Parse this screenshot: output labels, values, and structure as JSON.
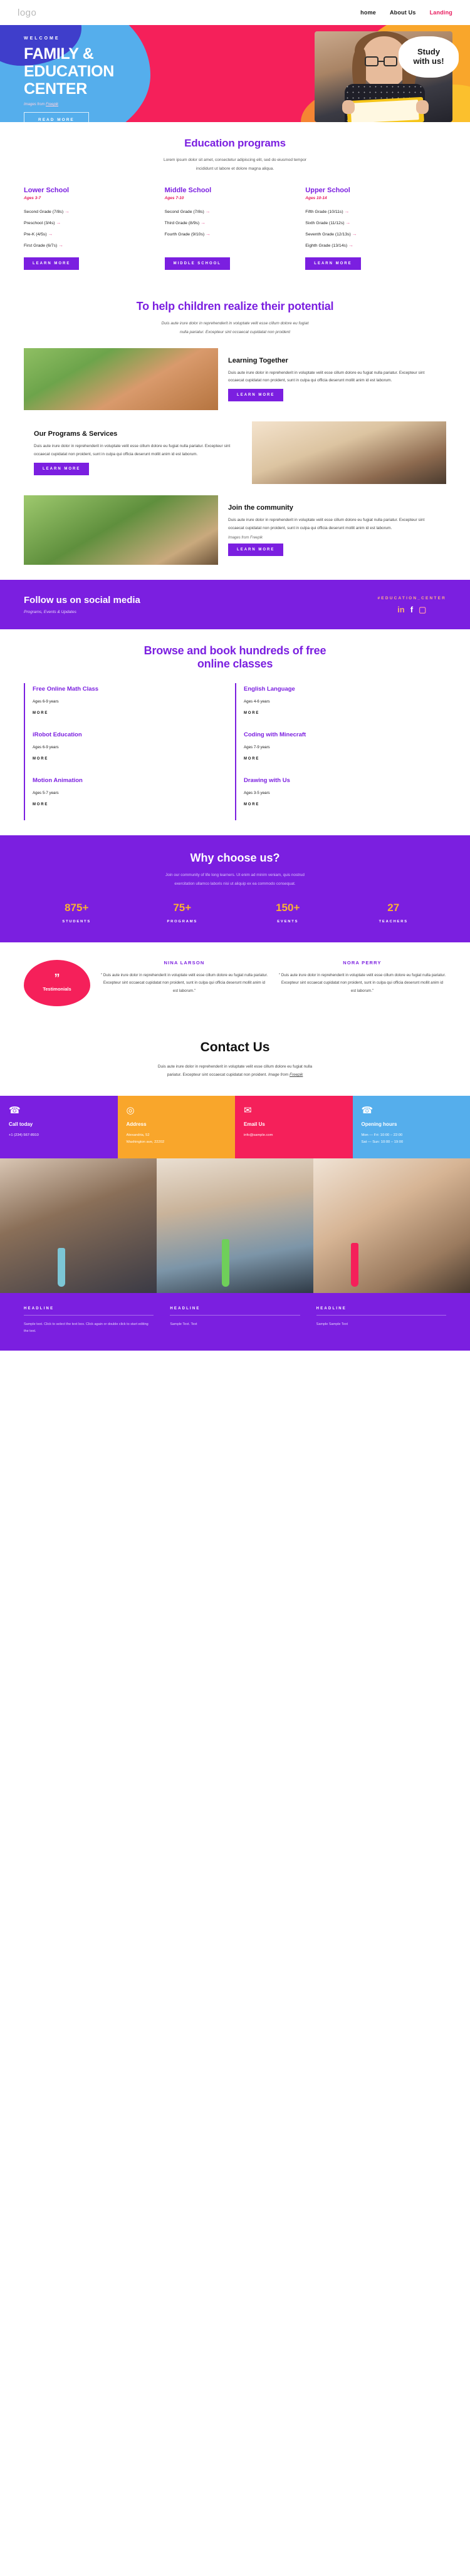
{
  "header": {
    "logo": "logo",
    "nav": [
      {
        "label": "home",
        "active": false
      },
      {
        "label": "About Us",
        "active": false
      },
      {
        "label": "Landing",
        "active": true
      }
    ]
  },
  "hero": {
    "welcome": "WELCOME",
    "title_line1": "FAMILY &",
    "title_line2": "EDUCATION",
    "title_line3": "CENTER",
    "credit_prefix": "Images from ",
    "credit_link": "Freepik",
    "cta": "READ MORE",
    "bubble_line1": "Study",
    "bubble_line2": "with us!"
  },
  "programs": {
    "title": "Education programs",
    "subtitle_line1": "Lorem ipsum dolor sit amet, consectetur adipiscing elit, sed do eiusmod tempor",
    "subtitle_line2": "incididunt ut labore et dolore magna aliqua.",
    "columns": [
      {
        "name": "Lower School",
        "ages": "Ages 3-7",
        "items": [
          "Second Grade (7/8s)",
          "Preschool (3/4s)",
          "Pre-K (4/5s)",
          "First Grade (6/7s)"
        ],
        "button": "LEARN MORE"
      },
      {
        "name": "Middle School",
        "ages": "Ages 7-10",
        "items": [
          "Second Grade (7/8s)",
          "Third Grade (8/9s)",
          "Fourth Grade (9/10s)"
        ],
        "button": "MIDDLE SCHOOL"
      },
      {
        "name": "Upper School",
        "ages": "Ages 10-14",
        "items": [
          "Fifth Grade (10/11s)",
          "Sixth Grade (11/12s)",
          "Seventh Grade (12/13s)",
          "Eighth Grade (13/14s)"
        ],
        "button": "LEARN MORE"
      }
    ]
  },
  "potential": {
    "title": "To help children realize their potential",
    "sub_line1": "Duis aute irure dolor in reprehenderit in voluptate velit esse cillum dolore eu fugiat",
    "sub_line2": "nulla pariatur. Excepteur sint occaecat cupidatat non proident",
    "cards": [
      {
        "title": "Learning Together",
        "body": "Duis aute irure dolor in reprehenderit in voluptate velit esse cillum dolore eu fugiat nulla pariatur. Excepteur sint occaecat cupidatat non proident, sunt in culpa qui officia deserunt mollit anim id est laborum.",
        "button": "LEARN MORE",
        "credit": ""
      },
      {
        "title": "Our Programs & Services",
        "body": "Duis aute irure dolor in reprehenderit in voluptate velit esse cillum dolore eu fugiat nulla pariatur. Excepteur sint occaecat cupidatat non proident, sunt in culpa qui officia deserunt mollit anim id est laborum.",
        "button": "LEARN MORE",
        "credit": ""
      },
      {
        "title": "Join the community",
        "body": "Duis aute irure dolor in reprehenderit in voluptate velit esse cillum dolore eu fugiat nulla pariatur. Excepteur sint occaecat cupidatat non proident, sunt in culpa qui officia deserunt mollit anim id est laborum.",
        "button": "LEARN MORE",
        "credit": "Images from Freepik"
      }
    ]
  },
  "social": {
    "title": "Follow us on social media",
    "subtitle": "Programs, Events & Updates",
    "hashtag": "#EDUCATION_CENTER",
    "icons": [
      "linkedin-icon",
      "facebook-icon",
      "instagram-icon"
    ]
  },
  "classes": {
    "title_line1": "Browse and book hundreds of free",
    "title_line2": "online classes",
    "more_label": "MORE",
    "items": [
      {
        "name": "Free Online Math Class",
        "ages": "Ages 6-9 years"
      },
      {
        "name": "English Language",
        "ages": "Ages 4-6 years"
      },
      {
        "name": "iRobot Education",
        "ages": "Ages 6-9 years"
      },
      {
        "name": "Coding with Minecraft",
        "ages": "Ages 7-9 years"
      },
      {
        "name": "Motion Animation",
        "ages": "Ages 5-7 years"
      },
      {
        "name": "Drawing with Us",
        "ages": "Ages 3-5 years"
      }
    ]
  },
  "why": {
    "title": "Why choose us?",
    "sub_line1": "Join our community of life long learners. Ut enim ad minim veniam, quis nostrud",
    "sub_line2": "exercitation ullamco laboris nisi ut aliquip ex ea commodo consequat.",
    "stats": [
      {
        "number": "875+",
        "label": "STUDENTS"
      },
      {
        "number": "75+",
        "label": "PROGRAMS"
      },
      {
        "number": "150+",
        "label": "EVENTS"
      },
      {
        "number": "27",
        "label": "TEACHERS"
      }
    ]
  },
  "testimonials": {
    "badge_quote": "”",
    "badge_label": "Testimonials",
    "entries": [
      {
        "name": "NINA LARSON",
        "text": "\" Duis aute irure dolor in reprehenderit in voluptate velit esse cillum dolore eu fugiat nulla pariatur. Excepteur sint occaecat cupidatat non proident, sunt in culpa qui officia deserunt mollit anim id est laborum.\""
      },
      {
        "name": "NORA PERRY",
        "text": "\" Duis aute irure dolor in reprehenderit in voluptate velit esse cillum dolore eu fugiat nulla pariatur. Excepteur sint occaecat cupidatat non proident, sunt in culpa qui officia deserunt mollit anim id est laborum.\""
      }
    ]
  },
  "contact": {
    "title": "Contact Us",
    "desc_line1": "Duis aute irure dolor in reprehenderit in voluptate velit esse cillum dolore eu fugiat nulla",
    "desc_line2": "pariatur. Excepteur sint occaecat cupidatat non proident. ",
    "desc_credit_prefix": "Image from ",
    "desc_credit_link": "Freepik",
    "cards": [
      {
        "icon": "phone-icon",
        "glyph": "☎",
        "title": "Call today",
        "line1": "+1 (234) 567-8910",
        "line2": ""
      },
      {
        "icon": "location-icon",
        "glyph": "◎",
        "title": "Address",
        "line1": "Alexandria, 52",
        "line2": "Washington ave, 22202"
      },
      {
        "icon": "mail-icon",
        "glyph": "✉",
        "title": "Email Us",
        "line1": "info@sample.com",
        "line2": ""
      },
      {
        "icon": "clock-icon",
        "glyph": "☎",
        "title": "Opening hours",
        "line1": "Mon — Fri: 10:00 – 22:00",
        "line2": "Sat — Sun: 10:00 – 19:00"
      }
    ]
  },
  "footer": {
    "columns": [
      {
        "heading": "HEADLINE",
        "text": "Sample text. Click to select the text box. Click again or double click to start editing the text."
      },
      {
        "heading": "HEADLINE",
        "text": "Sample Text. Text"
      },
      {
        "heading": "HEADLINE",
        "text": "Sample Sample Text"
      }
    ]
  },
  "colors": {
    "purple": "#7b1fe0",
    "pink": "#f5205a",
    "orange": "#f9a62b",
    "blue": "#55aeec",
    "accent_pink": "#e8195c"
  }
}
